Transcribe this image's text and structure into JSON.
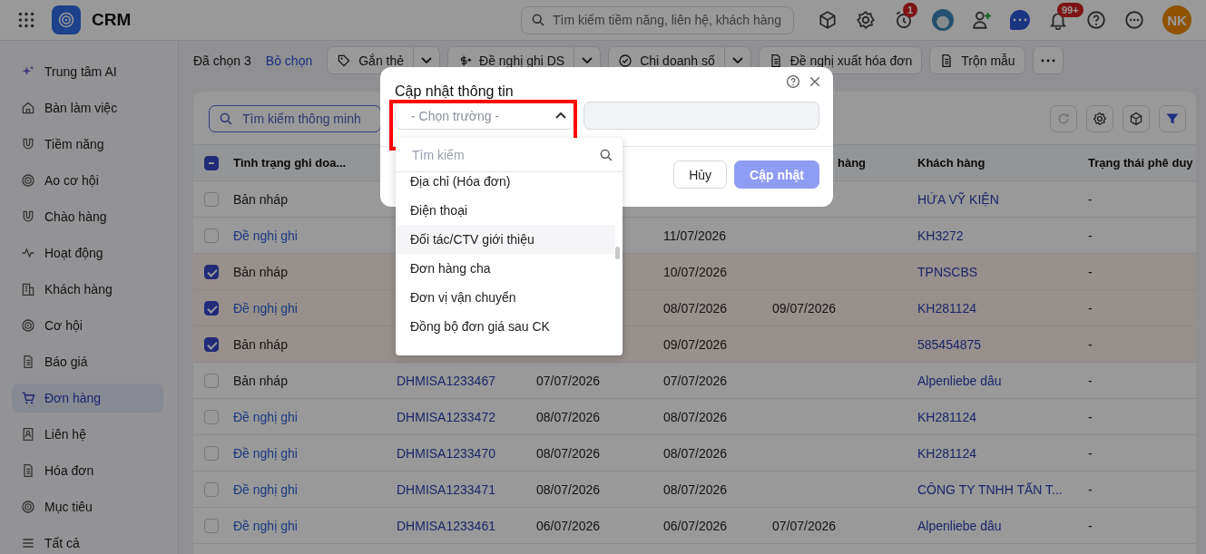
{
  "app": {
    "title": "CRM",
    "search_placeholder": "Tìm kiếm tiềm năng, liên hệ, khách hàng",
    "alarm_badge": "1",
    "bell_badge": "99+",
    "user_initials": "NK"
  },
  "sidebar": {
    "items": [
      {
        "label": "Trung tâm AI",
        "selected": false
      },
      {
        "label": "Bàn làm việc",
        "selected": false
      },
      {
        "label": "Tiềm năng",
        "selected": false
      },
      {
        "label": "Ao cơ hội",
        "selected": false
      },
      {
        "label": "Chào hàng",
        "selected": false
      },
      {
        "label": "Hoạt động",
        "selected": false
      },
      {
        "label": "Khách hàng",
        "selected": false
      },
      {
        "label": "Cơ hội",
        "selected": false
      },
      {
        "label": "Báo giá",
        "selected": false
      },
      {
        "label": "Đơn hàng",
        "selected": true
      },
      {
        "label": "Liên hệ",
        "selected": false
      },
      {
        "label": "Hóa đơn",
        "selected": false
      },
      {
        "label": "Mục tiêu",
        "selected": false
      },
      {
        "label": "Tất cả",
        "selected": false
      }
    ]
  },
  "selection_bar": {
    "count_text": "Đã chọn 3",
    "clear_link": "Bỏ chọn",
    "actions": [
      {
        "label": "Gắn thẻ",
        "split": true
      },
      {
        "label": "Đề nghị ghi DS",
        "split": true
      },
      {
        "label": "Chi doanh số",
        "split": true
      },
      {
        "label": "Đề nghị xuất hóa đơn",
        "split": false
      },
      {
        "label": "Trộn mẫu",
        "split": false
      }
    ]
  },
  "table": {
    "search_placeholder": "Tìm kiếm thông minh",
    "select_all_partial": true,
    "header": {
      "status": "Tình trạng ghi doa...",
      "date_3": "hàng",
      "customer": "Khách hàng",
      "approval": "Trạng thái phê duy"
    },
    "rows": [
      {
        "selected": false,
        "link": false,
        "status": "Bản nháp",
        "customer": "HỨA VỸ KIỆN",
        "approval": "-"
      },
      {
        "selected": false,
        "link": true,
        "status": "Đề nghị ghi",
        "date_2": "11/07/2026",
        "customer": "KH3272",
        "approval": "-"
      },
      {
        "selected": true,
        "link": false,
        "status": "Bản nháp",
        "date_2": "10/07/2026",
        "customer": "TPNSCBS",
        "approval": "-"
      },
      {
        "selected": true,
        "link": true,
        "status": "Đề nghị ghi",
        "date_2": "08/07/2026",
        "date_3": "09/07/2026",
        "customer": "KH281124",
        "approval": "-"
      },
      {
        "selected": true,
        "link": false,
        "status": "Bản nháp",
        "date_2": "09/07/2026",
        "customer": "585454875",
        "approval": "-"
      },
      {
        "selected": false,
        "link": false,
        "status": "Bản nháp",
        "code": "DHMISA1233467",
        "date_1": "07/07/2026",
        "date_2": "07/07/2026",
        "customer": "Alpenliebe dâu",
        "approval": "-"
      },
      {
        "selected": false,
        "link": true,
        "status": "Đề nghị ghi",
        "code": "DHMISA1233472",
        "date_1": "08/07/2026",
        "date_2": "08/07/2026",
        "customer": "KH281124",
        "approval": "-"
      },
      {
        "selected": false,
        "link": true,
        "status": "Đề nghị ghi",
        "code": "DHMISA1233470",
        "date_1": "08/07/2026",
        "date_2": "08/07/2026",
        "customer": "KH281124",
        "approval": "-"
      },
      {
        "selected": false,
        "link": true,
        "status": "Đề nghị ghi",
        "code": "DHMISA1233471",
        "date_1": "08/07/2026",
        "date_2": "08/07/2026",
        "customer": "CÔNG TY TNHH TẤN T...",
        "approval": "-"
      },
      {
        "selected": false,
        "link": true,
        "status": "Đề nghị ghi",
        "code": "DHMISA1233461",
        "date_1": "06/07/2026",
        "date_2": "06/07/2026",
        "date_3": "07/07/2026",
        "customer": "Alpenliebe dâu",
        "approval": "-"
      }
    ]
  },
  "dialog": {
    "title": "Cập nhật thông tin",
    "field_placeholder": "- Chọn trường -",
    "value_disabled": true,
    "cancel": "Hủy",
    "submit": "Cập nhật",
    "submit_disabled": true,
    "dropdown": {
      "search_placeholder": "Tìm kiếm",
      "items": [
        {
          "label": "Địa chỉ (Hóa đơn)",
          "highlighted": false
        },
        {
          "label": "Điện thoại",
          "highlighted": false
        },
        {
          "label": "Đối tác/CTV giới thiệu",
          "highlighted": true
        },
        {
          "label": "Đơn hàng cha",
          "highlighted": false
        },
        {
          "label": "Đơn vị vận chuyển",
          "highlighted": false
        },
        {
          "label": "Đồng bộ đơn giá sau CK",
          "highlighted": false
        }
      ]
    }
  }
}
